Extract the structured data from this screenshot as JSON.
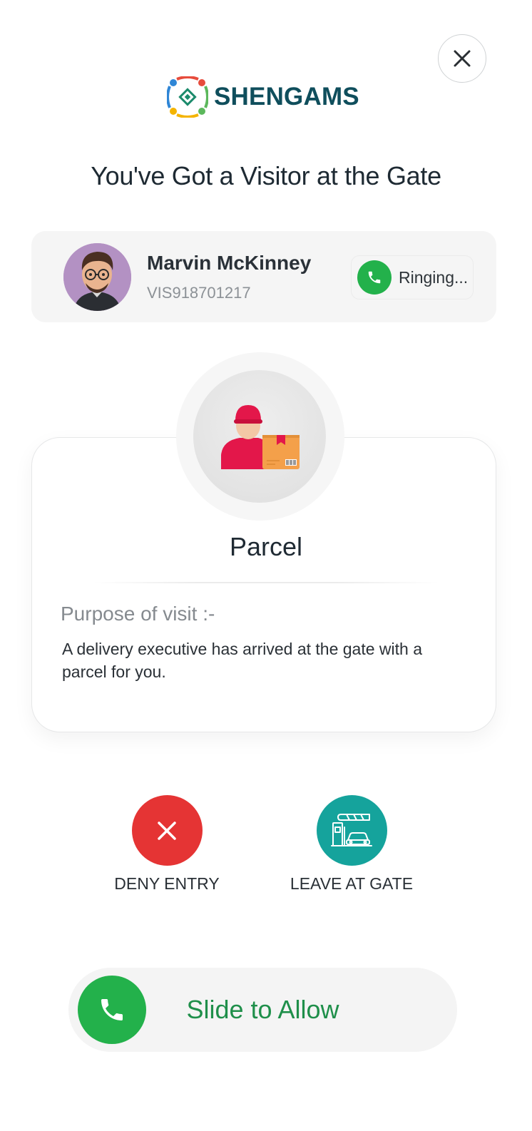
{
  "brand": {
    "name": "SHENGAMS"
  },
  "header": {
    "title": "You've Got a Visitor at the Gate"
  },
  "visitor": {
    "name": "Marvin McKinney",
    "id": "VIS918701217",
    "call_status": "Ringing..."
  },
  "visit": {
    "type": "Parcel",
    "purpose_label": "Purpose of visit :-",
    "purpose_text": "A delivery executive has arrived at the gate with a parcel for you."
  },
  "actions": {
    "deny_label": "DENY ENTRY",
    "leave_label": "LEAVE AT GATE"
  },
  "slider": {
    "label": "Slide to Allow"
  },
  "colors": {
    "brand": "#0f4e5c",
    "call_green": "#23b14b",
    "deny_red": "#e53434",
    "gate_teal": "#15a39c",
    "slide_text": "#1f8f4a"
  },
  "icons": {
    "close": "close-icon",
    "call": "phone-icon",
    "deny": "x-icon",
    "gate": "gate-barrier-icon",
    "visitor_type": "delivery-person-icon"
  }
}
